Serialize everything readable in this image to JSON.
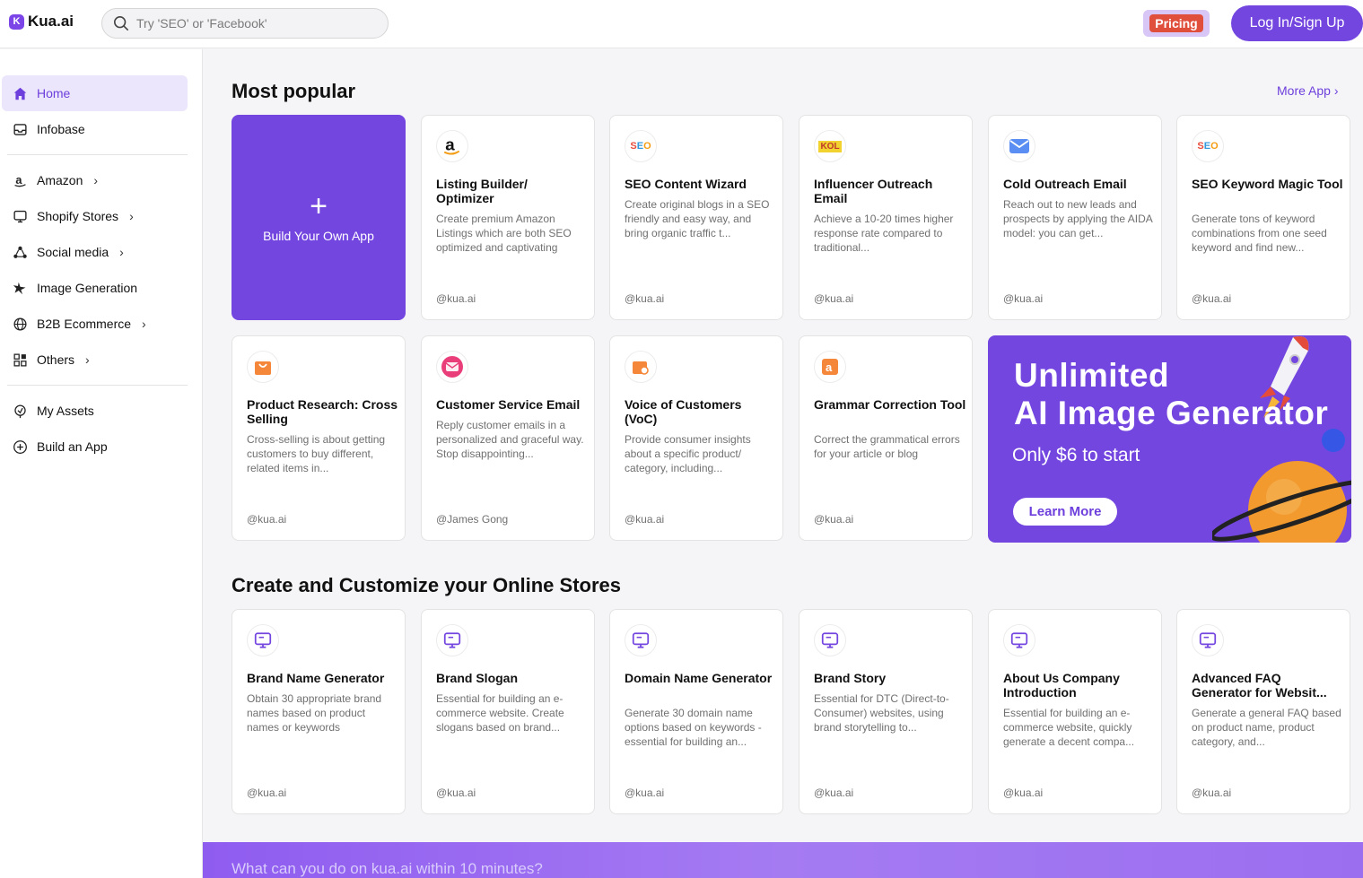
{
  "header": {
    "logo_text": "Kua.ai",
    "logo_mark": "K",
    "search_placeholder": "Try 'SEO' or 'Facebook'",
    "pricing_label": "Pricing",
    "login_label": "Log In/Sign Up"
  },
  "sidebar": {
    "items": [
      {
        "label": "Home",
        "icon": "home-icon"
      },
      {
        "label": "Infobase",
        "icon": "inbox-icon"
      },
      {
        "label": "Amazon",
        "icon": "amazon-icon"
      },
      {
        "label": "Shopify Stores",
        "icon": "monitor-icon"
      },
      {
        "label": "Social media",
        "icon": "share-icon"
      },
      {
        "label": "Image Generation",
        "icon": "sparkle-icon"
      },
      {
        "label": "B2B Ecommerce",
        "icon": "globe-icon"
      },
      {
        "label": "Others",
        "icon": "grid-icon"
      },
      {
        "label": "My Assets",
        "icon": "assets-icon"
      },
      {
        "label": "Build an App",
        "icon": "plus-circle-icon"
      }
    ]
  },
  "popular": {
    "title": "Most popular",
    "more_label": "More App",
    "build_label": "Build Your Own App",
    "cards": [
      {
        "title": "Listing Builder/ Optimizer",
        "desc": "Create premium Amazon Listings which are both SEO optimized and captivating",
        "author": "@kua.ai",
        "icon": "a"
      },
      {
        "title": "SEO Content Wizard",
        "desc": "Create original blogs in a SEO friendly and easy way, and bring organic traffic t...",
        "author": "@kua.ai",
        "icon": "SEO"
      },
      {
        "title": "Influencer Outreach Email",
        "desc": "Achieve a 10-20 times higher response rate compared to traditional...",
        "author": "@kua.ai",
        "icon": "KOL"
      },
      {
        "title": "Cold Outreach Email",
        "desc": "Reach out to new leads and prospects by applying the AIDA model: you can get...",
        "author": "@kua.ai",
        "icon": "mail"
      },
      {
        "title": "SEO Keyword Magic Tool",
        "desc": "Generate tons of keyword combinations from one seed keyword and find new...",
        "author": "@kua.ai",
        "icon": "SEO"
      },
      {
        "title": "Product Research: Cross Selling",
        "desc": "Cross-selling is about getting customers to buy different, related items in...",
        "author": "@kua.ai",
        "icon": "bag"
      },
      {
        "title": "Customer Service Email",
        "desc": "Reply customer emails in a personalized and graceful way. Stop disappointing...",
        "author": "@James Gong",
        "icon": "mail2"
      },
      {
        "title": "Voice of Customers (VoC)",
        "desc": "Provide consumer insights about a specific product/ category, including...",
        "author": "@kua.ai",
        "icon": "bag2"
      },
      {
        "title": "Grammar Correction Tool",
        "desc": "Correct the grammatical errors for your article or blog",
        "author": "@kua.ai",
        "icon": "a2"
      }
    ]
  },
  "banner": {
    "line1": "Unlimited",
    "line2": "AI Image Generator",
    "sub": "Only $6 to start",
    "button": "Learn More"
  },
  "stores": {
    "title": "Create and Customize your Online Stores",
    "cards": [
      {
        "title": "Brand Name Generator",
        "desc": "Obtain 30 appropriate brand names based on product names or keywords",
        "author": "@kua.ai"
      },
      {
        "title": "Brand Slogan",
        "desc": "Essential for building an e-commerce website. Create slogans based on brand...",
        "author": "@kua.ai"
      },
      {
        "title": "Domain Name Generator",
        "desc": "Generate 30 domain name options based on keywords - essential for building an...",
        "author": "@kua.ai"
      },
      {
        "title": "Brand Story",
        "desc": "Essential for DTC (Direct-to-Consumer) websites, using brand storytelling to...",
        "author": "@kua.ai"
      },
      {
        "title": "About Us Company Introduction",
        "desc": "Essential for building an e-commerce website, quickly generate a decent compa...",
        "author": "@kua.ai"
      },
      {
        "title": "Advanced FAQ Generator for Websit...",
        "desc": "Generate a general FAQ based on product name, product category, and...",
        "author": "@kua.ai"
      }
    ]
  },
  "footer_band": "What can you do on kua.ai within 10 minutes?",
  "colors": {
    "accent": "#7446e0",
    "pricing_badge": "#e04e3c"
  }
}
